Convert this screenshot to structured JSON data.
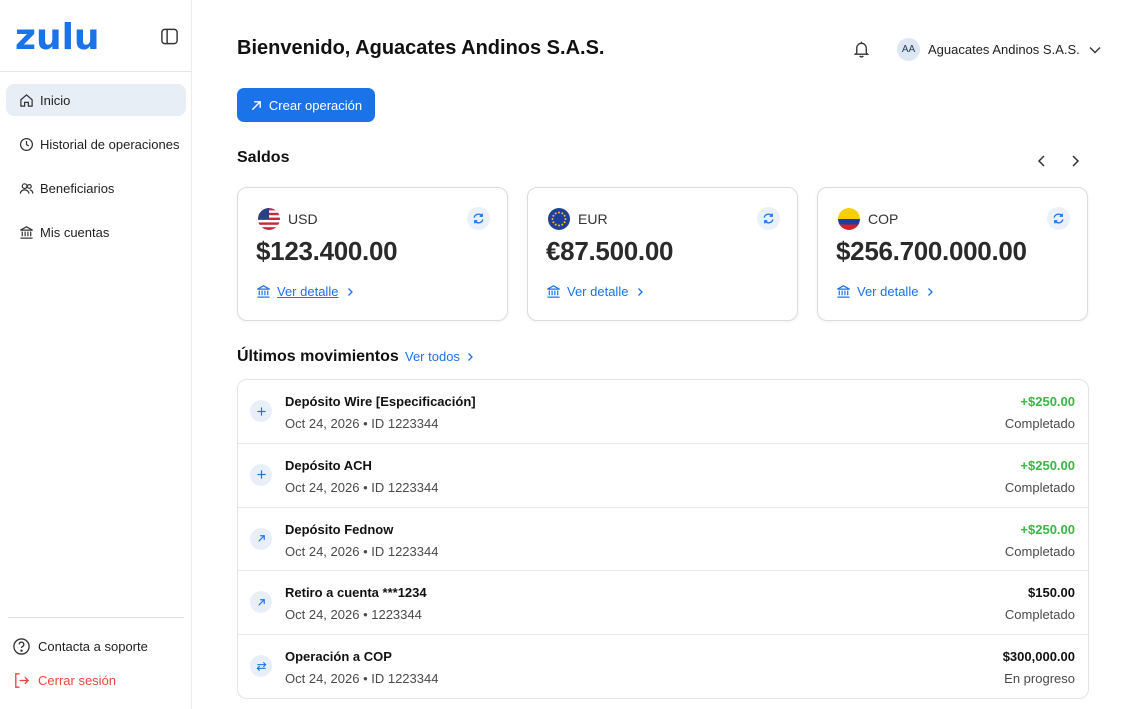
{
  "app": {
    "logo": "zulu"
  },
  "sidebar": {
    "items": [
      {
        "label": "Inicio",
        "icon": "home-icon",
        "active": true
      },
      {
        "label": "Historial de operaciones",
        "icon": "clock-icon"
      },
      {
        "label": "Beneficiarios",
        "icon": "users-icon"
      },
      {
        "label": "Mis cuentas",
        "icon": "bank-icon"
      }
    ],
    "support_label": "Contacta a soporte",
    "logout_label": "Cerrar sesión"
  },
  "header": {
    "welcome": "Bienvenido, Aguacates Andinos S.A.S.",
    "user_initials": "AA",
    "user_name": "Aguacates Andinos S.A.S."
  },
  "actions": {
    "create_label": "Crear operación"
  },
  "balances": {
    "title": "Saldos",
    "cards": [
      {
        "currency": "USD",
        "symbol": "$",
        "amount": "123.400.00",
        "detail_label": "Ver detalle",
        "flag": "us-flag-icon"
      },
      {
        "currency": "EUR",
        "symbol": "€",
        "amount": "87.500.00",
        "detail_label": "Ver detalle",
        "flag": "eu-flag-icon"
      },
      {
        "currency": "COP",
        "symbol": "$",
        "amount": "256.700.000.00",
        "detail_label": "Ver detalle",
        "flag": "co-flag-icon"
      }
    ]
  },
  "movements": {
    "title": "Últimos movimientos",
    "see_all_label": "Ver todos",
    "items": [
      {
        "title": "Depósito Wire [Especificación]",
        "date": "Oct 24, 2026",
        "id": "ID 1223344",
        "amount": "+$250.00",
        "status": "Completado",
        "icon": "plus-icon",
        "positive": true
      },
      {
        "title": "Depósito ACH",
        "date": "Oct 24, 2026",
        "id": "ID 1223344",
        "amount": "+$250.00",
        "status": "Completado",
        "icon": "plus-icon",
        "positive": true
      },
      {
        "title": "Depósito Fednow",
        "date": "Oct 24, 2026",
        "id": "ID 1223344",
        "amount": "+$250.00",
        "status": "Completado",
        "icon": "arrow-up-right-icon",
        "positive": true
      },
      {
        "title": "Retiro a cuenta ***1234",
        "date": "Oct 24, 2026",
        "id": "1223344",
        "amount": "$150.00",
        "status": "Completado",
        "icon": "arrow-up-right-icon",
        "positive": false
      },
      {
        "title": "Operación a COP",
        "date": "Oct 24, 2026",
        "id": "ID 1223344",
        "amount": "$300,000.00",
        "status": "En progreso",
        "icon": "exchange-icon",
        "positive": false
      }
    ]
  },
  "colors": {
    "accent": "#1a73e8",
    "positive": "#3bb54a",
    "danger": "#e5483b"
  }
}
